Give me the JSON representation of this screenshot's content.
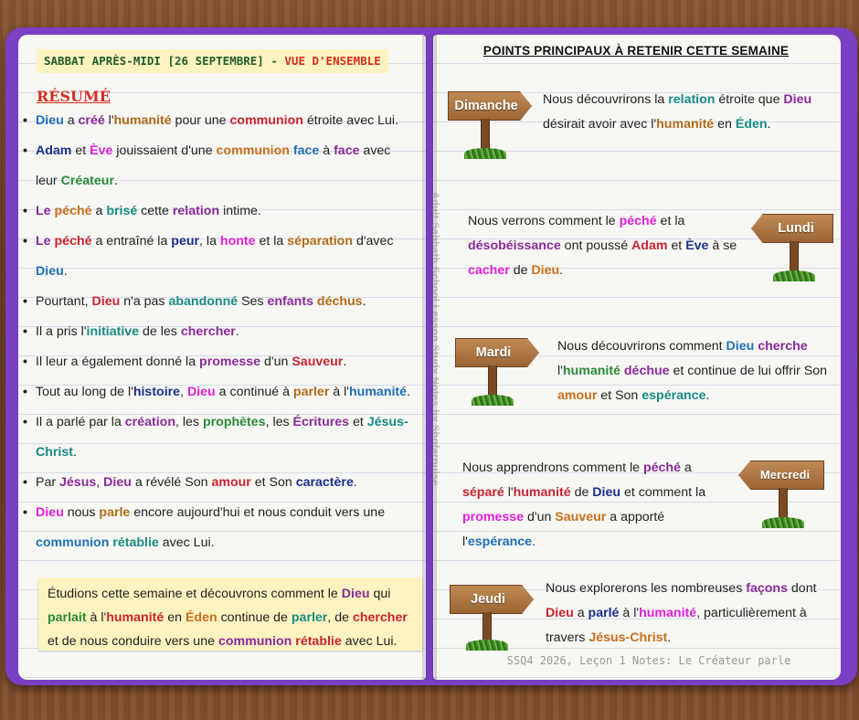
{
  "left": {
    "title_main": "SABBAT APRÈS-MIDI [26 SEPTEMBRE] - ",
    "title_accent": "VUE D'ENSEMBLE",
    "heading": "RÉSUMÉ",
    "bullets": [
      [
        "Dieu",
        " a ",
        "créé",
        " l'",
        "humanité",
        " pour une ",
        "communion",
        " étroite avec Lui."
      ],
      [
        "Adam",
        " et ",
        "Ève",
        " jouissaient d'une ",
        "communion",
        " ",
        "face",
        " à ",
        "face",
        " avec leur ",
        "Créateur",
        "."
      ],
      [
        "Le",
        " ",
        "péché",
        " a ",
        "brisé",
        " cette ",
        "relation",
        " intime."
      ],
      [
        "Le",
        " ",
        "péché",
        " a entraîné la ",
        "peur",
        ", la ",
        "honte",
        " et la ",
        "séparation",
        " d'avec ",
        "Dieu",
        "."
      ],
      [
        "Pourtant, ",
        "Dieu",
        " n'a pas ",
        "abandonné",
        " Ses ",
        "enfants",
        " ",
        "déchus",
        "."
      ],
      [
        "Il a pris l'",
        "initiative",
        " de les ",
        "chercher",
        "."
      ],
      [
        "Il leur a également donné la ",
        "promesse",
        " d'un ",
        "Sauveur",
        "."
      ],
      [
        "Tout au long de l'",
        "histoire",
        ", ",
        "Dieu",
        " a continué à ",
        "parler",
        " à l'",
        "humanité",
        "."
      ],
      [
        "Il a parlé par la ",
        "création",
        ", les ",
        "prophètes",
        ", les ",
        "Écritures",
        " et ",
        "Jésus-Christ",
        "."
      ],
      [
        "Par ",
        "Jésus",
        ", ",
        "Dieu",
        " a révélé Son ",
        "amour",
        " et Son ",
        "caractère",
        "."
      ],
      [
        "Dieu",
        " nous ",
        "parle",
        " encore aujourd'hui et nous conduit vers une ",
        "communion",
        " ",
        "rétablie",
        " avec Lui."
      ]
    ],
    "callout": [
      "Étudions cette semaine et découvrons comment le ",
      "Dieu",
      " qui ",
      "parlait",
      " à l'",
      "humanité",
      " en ",
      "Éden",
      " continue de ",
      "parler",
      ", de ",
      "chercher",
      " et de nous conduire vers une ",
      "communion",
      " ",
      "rétablie",
      " avec Lui."
    ]
  },
  "watermark": "Adult Sabbath School Lesson Study Notes by Shofarpulse",
  "right": {
    "title": "POINTS PRINCIPAUX À RETENIR CETTE SEMAINE",
    "days": [
      {
        "label": "Dimanche",
        "text": [
          "Nous découvrirons la ",
          "relation",
          " étroite que ",
          "Dieu",
          " désirait avoir avec l'",
          "humanité",
          " en ",
          "Éden",
          "."
        ]
      },
      {
        "label": "Lundi",
        "text": [
          "Nous verrons comment le ",
          "péché",
          " et la ",
          "désobéissance",
          " ont poussé ",
          "Adam",
          " et ",
          "Ève",
          " à se ",
          "cacher",
          " de ",
          "Dieu",
          "."
        ]
      },
      {
        "label": "Mardi",
        "text": [
          "Nous découvrirons comment ",
          "Dieu",
          " ",
          "cherche",
          " l'",
          "humanité",
          " ",
          "déchue",
          " et continue de lui offrir Son ",
          "amour",
          " et Son ",
          "espérance",
          "."
        ]
      },
      {
        "label": "Mercredi",
        "text": [
          "Nous apprendrons comment le ",
          "péché",
          " a ",
          "séparé",
          " l'",
          "humanité",
          " de ",
          "Dieu",
          " et comment la ",
          "promesse",
          " d'un ",
          "Sauveur",
          " a apporté l'",
          "espérance",
          "."
        ]
      },
      {
        "label": "Jeudi",
        "text": [
          "Nous explorerons les nombreuses ",
          "façons",
          " dont ",
          "Dieu",
          " a ",
          "parlé",
          " à l'",
          "humanité",
          ", particulièrement à travers ",
          "Jésus-Christ",
          "."
        ]
      }
    ],
    "footer": "SSQ4 2026, Leçon 1 Notes: Le Créateur parle"
  },
  "colors": {
    "cover": "#7b3fc4",
    "heading_red": "#d3301f",
    "title_green": "#1f5c2a",
    "callout_bg": "#fdf3c0"
  }
}
